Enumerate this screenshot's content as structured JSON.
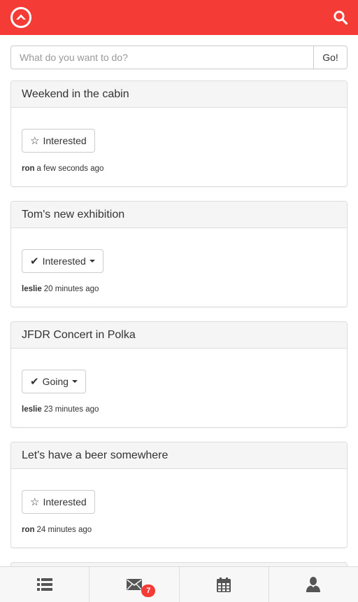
{
  "colors": {
    "brand": "#f53b36",
    "panel_heading_bg": "#f5f5f5",
    "tabbar_bg": "#f7f7f7"
  },
  "topbar": {
    "logo_icon": "circle-arrow-up-logo",
    "search_icon": "search-icon"
  },
  "search": {
    "placeholder": "What do you want to do?",
    "value": "",
    "button_label": "Go!"
  },
  "events": [
    {
      "title": "Weekend in the cabin",
      "rsvp_icon": "star-outline-icon",
      "rsvp_glyph": "☆",
      "rsvp_label": "Interested",
      "has_dropdown": false,
      "user": "ron",
      "time": "a few seconds ago"
    },
    {
      "title": "Tom's new exhibition",
      "rsvp_icon": "checkmark-icon",
      "rsvp_glyph": "✔",
      "rsvp_label": "Interested",
      "has_dropdown": true,
      "user": "leslie",
      "time": "20 minutes ago"
    },
    {
      "title": "JFDR Concert in Polka",
      "rsvp_icon": "checkmark-icon",
      "rsvp_glyph": "✔",
      "rsvp_label": "Going",
      "has_dropdown": true,
      "user": "leslie",
      "time": "23 minutes ago"
    },
    {
      "title": "Let's have a beer somewhere",
      "rsvp_icon": "star-outline-icon",
      "rsvp_glyph": "☆",
      "rsvp_label": "Interested",
      "has_dropdown": false,
      "user": "ron",
      "time": "24 minutes ago"
    }
  ],
  "tabbar": {
    "tabs": [
      {
        "name": "list",
        "icon": "list-icon"
      },
      {
        "name": "messages",
        "icon": "envelope-icon",
        "badge": "7"
      },
      {
        "name": "calendar",
        "icon": "calendar-icon"
      },
      {
        "name": "profile",
        "icon": "user-icon"
      }
    ]
  }
}
